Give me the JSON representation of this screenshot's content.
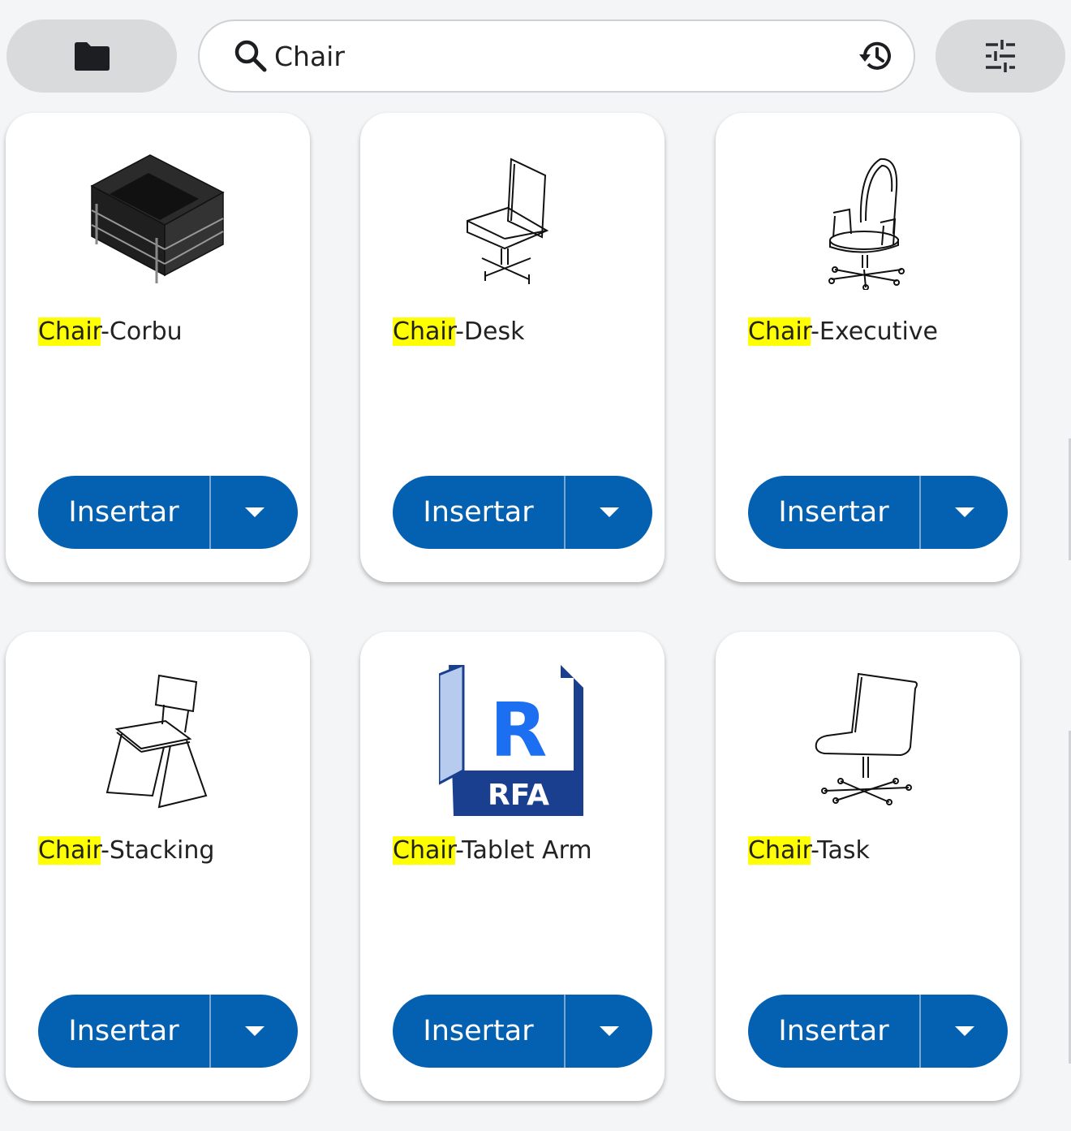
{
  "toolbar": {
    "folder_icon": "folder-icon",
    "search_value": "Chair",
    "search_icon": "search-icon",
    "history_icon": "history-icon",
    "filter_icon": "tune-icon"
  },
  "highlight_color": "#ffff00",
  "button_color": "#0461b2",
  "cards": [
    {
      "highlight": "Chair",
      "rest": "-Corbu",
      "insert_label": "Insertar",
      "thumbnail": "armchair-corbu"
    },
    {
      "highlight": "Chair",
      "rest": "-Desk",
      "insert_label": "Insertar",
      "thumbnail": "desk-chair"
    },
    {
      "highlight": "Chair",
      "rest": "-Executive",
      "insert_label": "Insertar",
      "thumbnail": "executive-chair"
    },
    {
      "highlight": "Chair",
      "rest": "-Stacking",
      "insert_label": "Insertar",
      "thumbnail": "stacking-chair"
    },
    {
      "highlight": "Chair",
      "rest": "-Tablet Arm",
      "insert_label": "Insertar",
      "thumbnail": "rfa-file-icon",
      "thumbnail_text_letter": "R",
      "thumbnail_text_label": "RFA"
    },
    {
      "highlight": "Chair",
      "rest": "-Task",
      "insert_label": "Insertar",
      "thumbnail": "task-chair"
    }
  ]
}
